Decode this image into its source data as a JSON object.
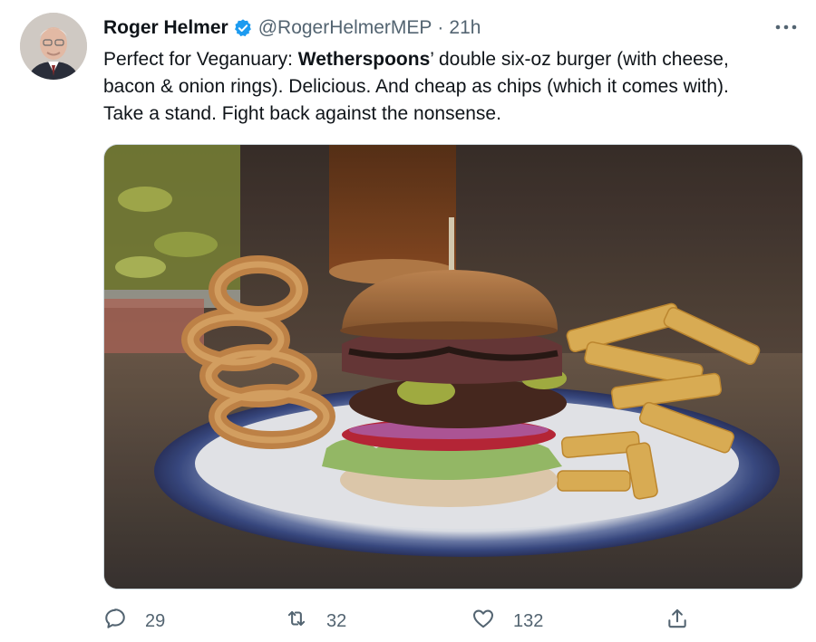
{
  "tweet": {
    "author_name": "Roger Helmer",
    "handle": "@RogerHelmerMEP",
    "separator": "·",
    "time": "21h",
    "text": {
      "line1_before": "Perfect for Veganuary: ",
      "line1_bold": "Wetherspoons",
      "line1_after": "’ double six-oz burger (with cheese,",
      "line2": "bacon & onion rings). Delicious. And cheap as chips (which it comes with).",
      "line3": "Take a stand.  Fight back against the nonsense."
    }
  },
  "actions": {
    "reply_count": "29",
    "retweet_count": "32",
    "like_count": "132"
  },
  "icons": {
    "verified": "verified-badge-icon",
    "more": "more-dots-icon",
    "reply": "reply-icon",
    "retweet": "retweet-icon",
    "like": "heart-icon",
    "share": "share-icon"
  },
  "colors": {
    "text": "#0f1419",
    "secondary": "#536471",
    "verified_blue": "#1d9bf0"
  }
}
